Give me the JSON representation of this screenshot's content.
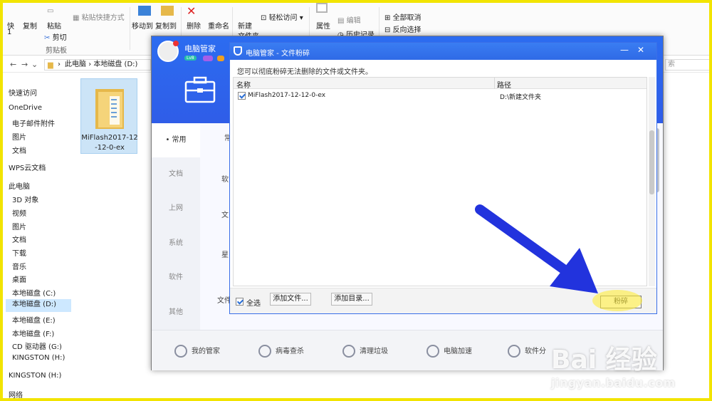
{
  "ribbon": {
    "pin_label": "快",
    "pin_label2": "1",
    "copy": "复制",
    "paste": "粘贴",
    "paste_shortcut": "粘贴快捷方式",
    "cut": "剪切",
    "clipboard_group": "剪贴板",
    "move_to": "移动到",
    "copy_to": "复制到",
    "delete": "删除",
    "rename": "重命名",
    "new_folder": "新建\n文件夹",
    "new_folder_a": "新建",
    "new_folder_b": "文件夹",
    "easy_access": "轻松访问",
    "properties": "属性",
    "edit": "编辑",
    "history": "历史记录",
    "select_all": "全部取消",
    "invert_selection": "反向选择"
  },
  "address": {
    "this_pc": "此电脑",
    "local_disk": "本地磁盘 (D:)",
    "search_placeholder": "索"
  },
  "nav_pane": {
    "items": [
      {
        "label": "快速访问"
      },
      {
        "label": "OneDrive"
      },
      {
        "label": "电子邮件附件"
      },
      {
        "label": "图片"
      },
      {
        "label": "文档"
      },
      {
        "label": "WPS云文档"
      },
      {
        "label": "此电脑"
      },
      {
        "label": "3D 对象"
      },
      {
        "label": "视频"
      },
      {
        "label": "图片"
      },
      {
        "label": "文档"
      },
      {
        "label": "下载"
      },
      {
        "label": "音乐"
      },
      {
        "label": "桌面"
      },
      {
        "label": "本地磁盘 (C:)"
      },
      {
        "label": "本地磁盘 (D:)"
      },
      {
        "label": "本地磁盘 (E:)"
      },
      {
        "label": "本地磁盘 (F:)"
      },
      {
        "label": "CD 驱动器 (G:)"
      },
      {
        "label": "KINGSTON (H:)"
      },
      {
        "label": "KINGSTON (H:)"
      },
      {
        "label": "网络"
      }
    ]
  },
  "content": {
    "folder_name_line1": "MiFlash2017-12",
    "folder_name_line2": "-12-0-ex"
  },
  "pcm": {
    "title": "电脑管家",
    "badge_lv": "Lv8",
    "tabs": [
      "常用",
      "文档",
      "上网",
      "系统",
      "软件",
      "其他"
    ],
    "mid_labels": [
      "常",
      "软",
      "文",
      "星",
      "文件"
    ],
    "bottom": [
      "我的管家",
      "病毒查杀",
      "清理垃圾",
      "电脑加速",
      "软件分"
    ]
  },
  "dialog": {
    "title": "电脑管家 - 文件粉碎",
    "hint": "您可以彻底粉碎无法删除的文件或文件夹。",
    "col_name": "名称",
    "col_path": "路径",
    "rows": [
      {
        "name": "MiFlash2017-12-12-0-ex",
        "path": "D:\\新建文件夹"
      }
    ],
    "select_all": "全选",
    "add_file": "添加文件...",
    "add_dir": "添加目录...",
    "shred": "粉碎"
  },
  "watermark": {
    "logo": "Bai 经验",
    "url": "jingyan.baidu.com"
  },
  "colors": {
    "frame": "#f2e400",
    "arrow": "#2233dd",
    "accent": "#2f6ae6"
  }
}
